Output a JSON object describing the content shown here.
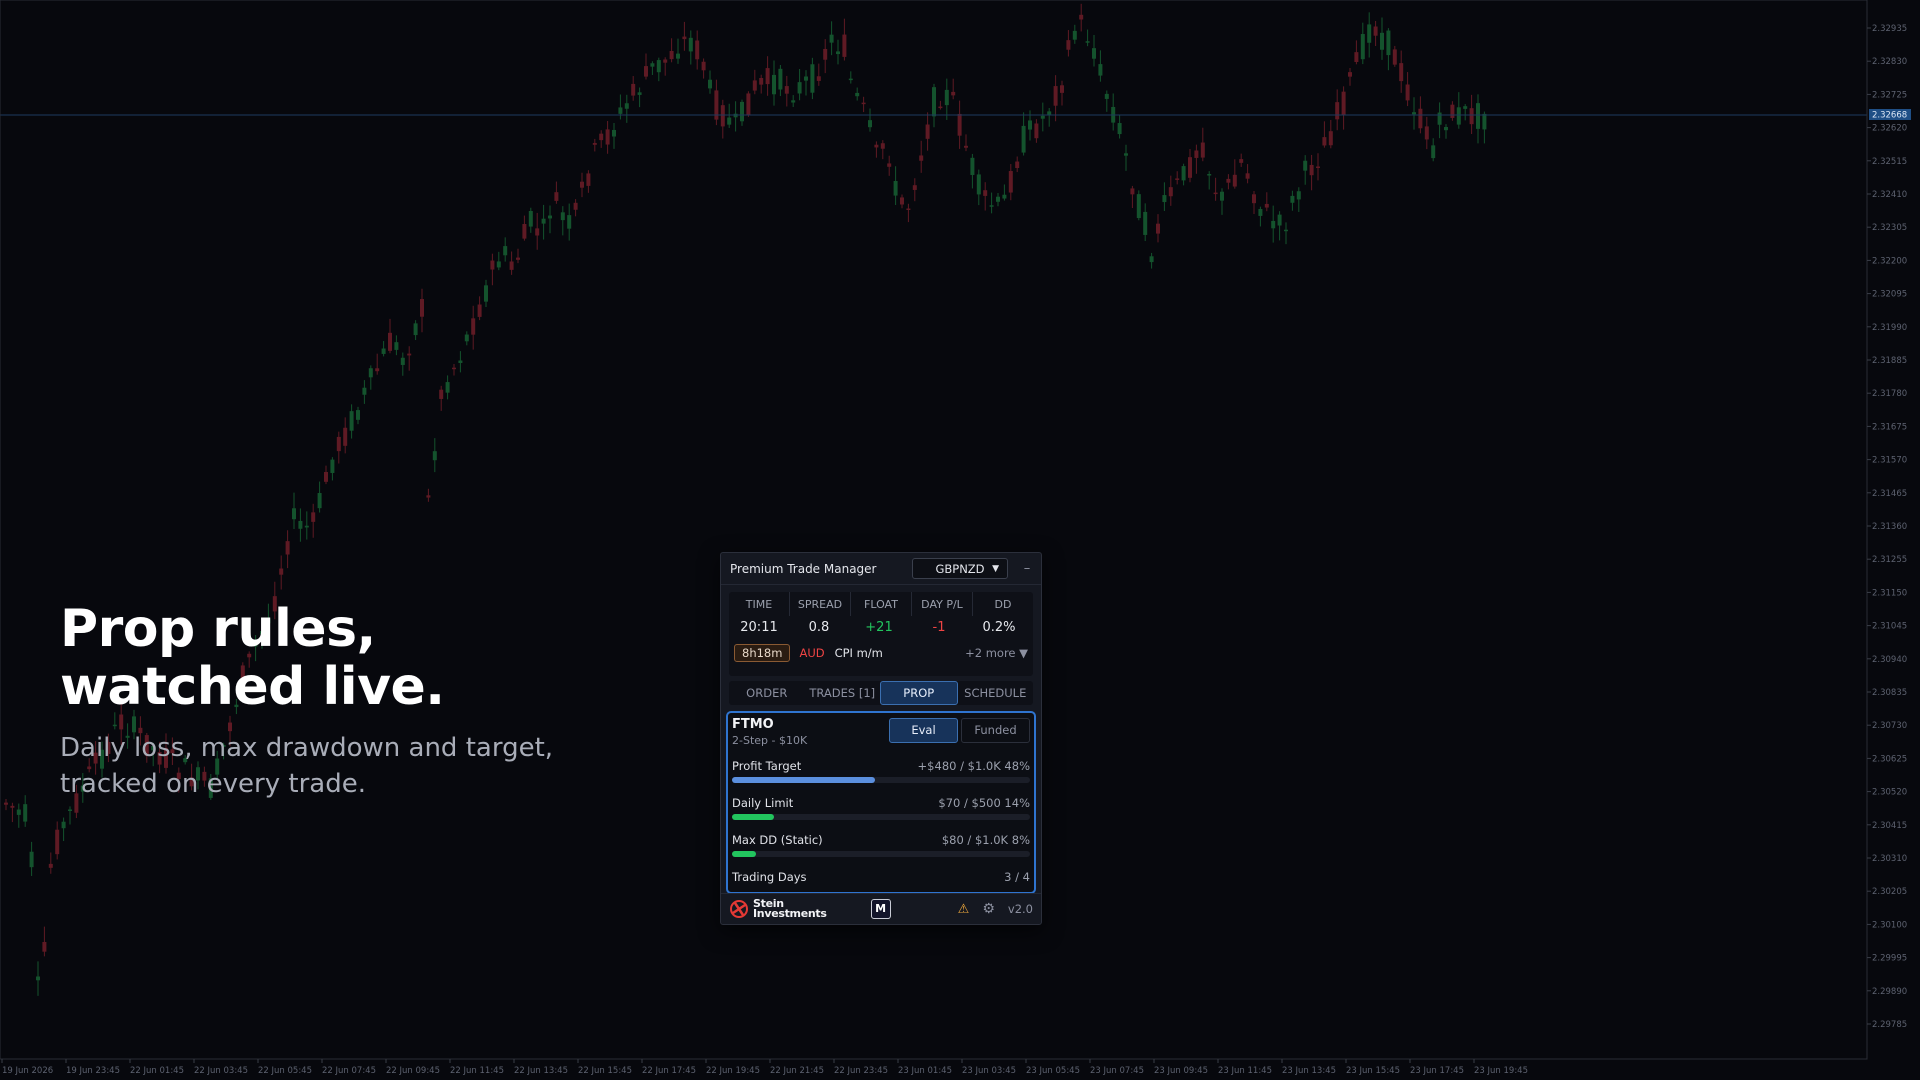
{
  "chart": {
    "symbol": "GBPNZD",
    "current_price_label": "2.32668",
    "price_labels": [
      "2.32935",
      "2.32830",
      "2.32725",
      "2.32620",
      "2.32515",
      "2.32410",
      "2.32305",
      "2.32200",
      "2.32095",
      "2.31990",
      "2.31885",
      "2.31780",
      "2.31675",
      "2.31570",
      "2.31465",
      "2.31360",
      "2.31255",
      "2.31150",
      "2.31045",
      "2.30940",
      "2.30835",
      "2.30730",
      "2.30625",
      "2.30520",
      "2.30415",
      "2.30310",
      "2.30205",
      "2.30100",
      "2.29995",
      "2.29890",
      "2.29785"
    ],
    "time_labels": [
      "19 Jun 2026",
      "19 Jun 23:45",
      "22 Jun 01:45",
      "22 Jun 03:45",
      "22 Jun 05:45",
      "22 Jun 07:45",
      "22 Jun 09:45",
      "22 Jun 11:45",
      "22 Jun 13:45",
      "22 Jun 15:45",
      "22 Jun 17:45",
      "22 Jun 19:45",
      "22 Jun 21:45",
      "22 Jun 23:45",
      "23 Jun 01:45",
      "23 Jun 03:45",
      "23 Jun 05:45",
      "23 Jun 07:45",
      "23 Jun 09:45",
      "23 Jun 11:45",
      "23 Jun 13:45",
      "23 Jun 15:45",
      "23 Jun 17:45",
      "23 Jun 19:45"
    ],
    "bull_color": "#14532d",
    "bear_color": "#5f1a24"
  },
  "hero": {
    "title_line1": "Prop rules,",
    "title_line2": "watched live.",
    "subtitle_line1": "Daily loss, max drawdown and target,",
    "subtitle_line2": "tracked on every trade."
  },
  "panel": {
    "title": "Premium Trade Manager",
    "symbol": "GBPNZD",
    "minimize": "–",
    "stats_headers": [
      "TIME",
      "SPREAD",
      "FLOAT",
      "DAY P/L",
      "DD"
    ],
    "stats_values": {
      "time": "20:11",
      "spread": "0.8",
      "float": "+21",
      "day_pl": "-1",
      "dd": "0.2%"
    },
    "news": {
      "countdown": "8h18m",
      "currency": "AUD",
      "event": "CPI m/m",
      "more": "+2 more ▼"
    },
    "tabs": [
      "ORDER",
      "TRADES [1]",
      "PROP",
      "SCHEDULE"
    ],
    "active_tab": "PROP",
    "prop": {
      "firm": "FTMO",
      "plan": "2-Step  -  $10K",
      "mode_eval": "Eval",
      "mode_funded": "Funded",
      "rules": [
        {
          "label": "Profit Target",
          "value": "+$480 / $1.0K  48%",
          "progress": 0.48,
          "color": "#5b8fde"
        },
        {
          "label": "Daily Limit",
          "value": "$70 / $500  14%",
          "progress": 0.14,
          "color": "#22c55e"
        },
        {
          "label": "Max DD (Static)",
          "value": "$80 / $1.0K  8%",
          "progress": 0.08,
          "color": "#22c55e"
        }
      ],
      "trading_days_label": "Trading Days",
      "trading_days_value": "3 / 4"
    },
    "footer": {
      "brand_line1": "Stein",
      "brand_line2": "Investments",
      "m_button": "M",
      "warning_icon": "⚠",
      "settings_icon": "⚙",
      "version": "v2.0"
    }
  }
}
